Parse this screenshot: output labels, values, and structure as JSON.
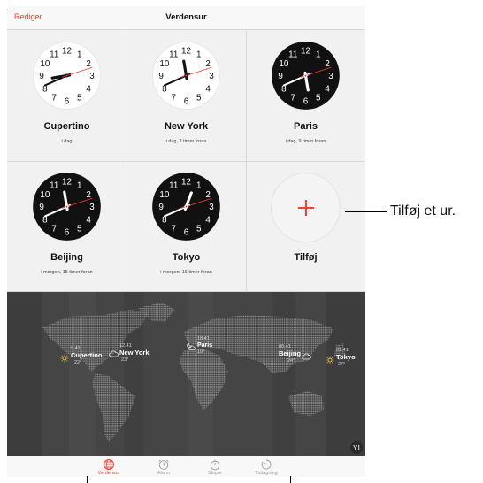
{
  "nav": {
    "edit_label": "Rediger",
    "title": "Verdensur"
  },
  "clocks": [
    {
      "city": "Cupertino",
      "subtitle": "i dag",
      "theme": "light",
      "hour": 8.0,
      "minute": 41,
      "second": 12
    },
    {
      "city": "New York",
      "subtitle": "i dag, 3 timer foran",
      "theme": "light",
      "hour": 11.0,
      "minute": 41,
      "second": 12
    },
    {
      "city": "Paris",
      "subtitle": "i dag, 9 timer foran",
      "theme": "dark",
      "hour": 5.0,
      "minute": 41,
      "second": 12
    },
    {
      "city": "Beijing",
      "subtitle": "i morgen, 15 timer foran",
      "theme": "dark",
      "hour": 11.0,
      "minute": 41,
      "second": 12
    },
    {
      "city": "Tokyo",
      "subtitle": "i morgen, 16 timer foran",
      "theme": "dark",
      "hour": 12.0,
      "minute": 41,
      "second": 12
    }
  ],
  "clock_numerals": [
    "12",
    "1",
    "2",
    "3",
    "4",
    "5",
    "6",
    "7",
    "8",
    "9",
    "10",
    "11"
  ],
  "add": {
    "label": "Tilføj",
    "callout": "Tilføj et ur."
  },
  "map_labels": [
    {
      "time": "9.41",
      "city": "Cupertino",
      "temp": "22°",
      "weather": "sun-icon"
    },
    {
      "time": "12.41",
      "city": "New York",
      "temp": "23°",
      "weather": "cloud-icon"
    },
    {
      "time": "18.41",
      "city": "Paris",
      "temp": "19°",
      "weather": "moon-cloud-icon"
    },
    {
      "time": "00.41",
      "city": "Beijing",
      "temp": "24°",
      "weather": "cloud-icon"
    },
    {
      "time": "01.41",
      "city": "Tokyo",
      "temp": "27°",
      "weather": "sun-icon"
    }
  ],
  "tabs": [
    {
      "label": "Verdensur",
      "icon": "globe-icon",
      "active": true
    },
    {
      "label": "Alarm",
      "icon": "alarm-clock-icon",
      "active": false
    },
    {
      "label": "Stopur",
      "icon": "stopwatch-icon",
      "active": false
    },
    {
      "label": "Tidtagning",
      "icon": "timer-icon",
      "active": false
    }
  ],
  "colors": {
    "accent": "#ff3b30",
    "map": "#454545",
    "land": "#8d8d8d"
  },
  "logo": "Y!"
}
